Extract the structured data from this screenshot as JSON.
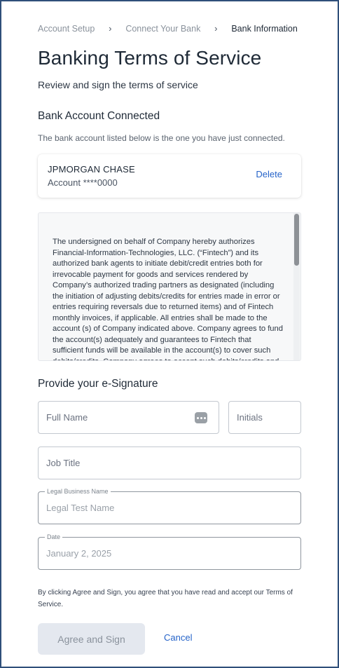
{
  "breadcrumb": {
    "items": [
      "Account Setup",
      "Connect Your Bank",
      "Bank Information"
    ],
    "separator": "›"
  },
  "header": {
    "title": "Banking Terms of Service",
    "subtitle": "Review and sign the terms of service"
  },
  "bank_section": {
    "heading": "Bank Account Connected",
    "helper": "The bank account listed below is the one you have just connected.",
    "bank_name": "JPMORGAN CHASE",
    "account": "Account ****0000",
    "delete_label": "Delete"
  },
  "terms": {
    "text": "The undersigned on behalf of Company hereby authorizes Financial-Information-Technologies, LLC. (“Fintech”) and its authorized bank agents to initiate debit/credit entries both for irrevocable payment for goods and services rendered by Company’s authorized trading partners as designated (including the initiation of adjusting debits/credits for entries made in error or entries requiring reversals due to returned items) and of Fintech monthly invoices, if applicable. All entries shall be made to the account (s) of Company indicated above. Company agrees to fund the account(s) adequately and guarantees to Fintech that sufficient funds will be available in the account(s) to cover such debits/credits. Company agrees to accept such debits/credits and"
  },
  "signature": {
    "heading": "Provide your e-Signature",
    "full_name_placeholder": "Full Name",
    "initials_placeholder": "Initials",
    "job_title_placeholder": "Job Title",
    "legal_business_label": "Legal Business Name",
    "legal_business_value": "Legal Test Name",
    "date_label": "Date",
    "date_value": "January 2, 2025"
  },
  "footer": {
    "agree_text": "By clicking Agree and Sign, you agree that you have read and accept our Terms of Service.",
    "agree_button": "Agree and Sign",
    "cancel_button": "Cancel"
  },
  "colors": {
    "accent": "#2563c9",
    "frame_border": "#2f4f7a",
    "disabled_button_bg": "#e4e8ef"
  }
}
